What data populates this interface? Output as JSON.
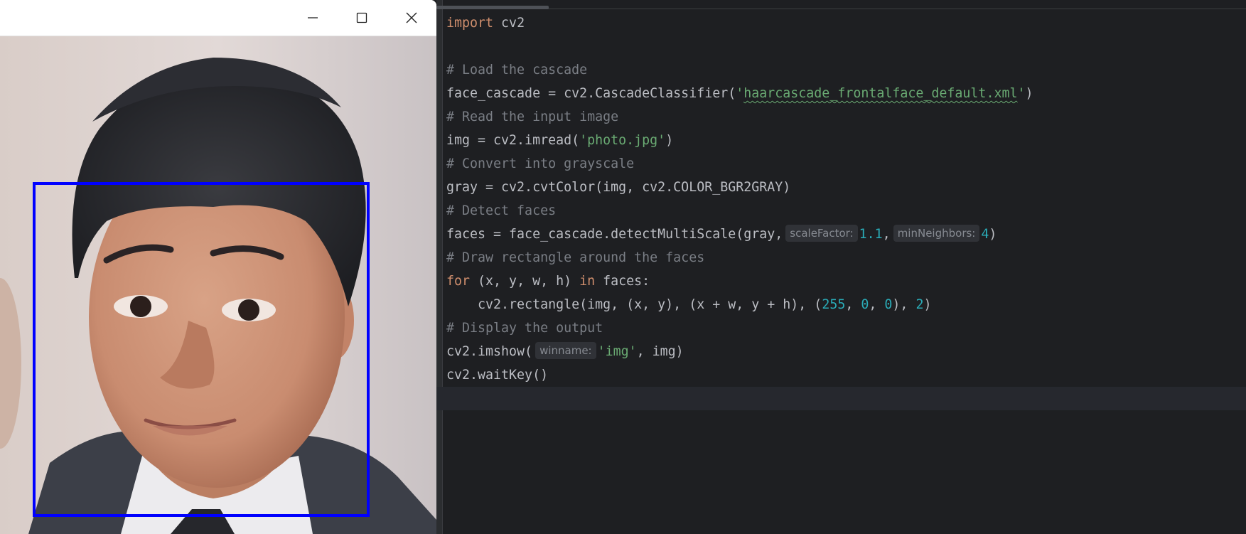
{
  "image_window": {
    "buttons": {
      "minimize": "minimize-icon",
      "maximize": "maximize-icon",
      "close": "close-icon"
    },
    "detection_box_color": "#0000ff"
  },
  "editor": {
    "colors": {
      "background": "#1e1f22",
      "keyword": "#cf8e6d",
      "comment": "#7a7e85",
      "string": "#6aab73",
      "number": "#2aacb8",
      "text": "#bcbec4"
    },
    "lines": [
      {
        "kw": "import",
        "rest": " cv2"
      },
      {
        "blank": ""
      },
      {
        "comment": "# Load the cascade"
      },
      {
        "a": "face_cascade = cv2.CascadeClassifier(",
        "str": "'haarcascade_frontalface_default.xml'",
        "b": ")"
      },
      {
        "comment": "# Read the input image"
      },
      {
        "a": "img = cv2.imread(",
        "str": "'photo.jpg'",
        "b": ")"
      },
      {
        "comment": "# Convert into grayscale"
      },
      {
        "a": "gray = cv2.cvtColor(img, cv2.COLOR_BGR2GRAY)"
      },
      {
        "comment": "# Detect faces"
      },
      {
        "a": "faces = face_cascade.detectMultiScale(gray,",
        "hint1": "scaleFactor:",
        "n1": "1.1",
        "sep": ",",
        "hint2": "minNeighbors:",
        "n2": "4",
        "b": ")"
      },
      {
        "comment": "# Draw rectangle around the faces"
      },
      {
        "kw1": "for",
        "mid": " (x, y, w, h) ",
        "kw2": "in",
        "rest": " faces:"
      },
      {
        "a": "    cv2.rectangle(img, (x, y), (x + w, y + h), (",
        "n1": "255",
        "s1": ", ",
        "n2": "0",
        "s2": ", ",
        "n3": "0",
        "s3": "), ",
        "n4": "2",
        "b": ")"
      },
      {
        "comment": "# Display the output"
      },
      {
        "a": "cv2.imshow(",
        "hint": "winname:",
        "str": "'img'",
        "b": ", img)"
      },
      {
        "a": "cv2.waitKey()"
      },
      {
        "blank": ""
      }
    ]
  }
}
